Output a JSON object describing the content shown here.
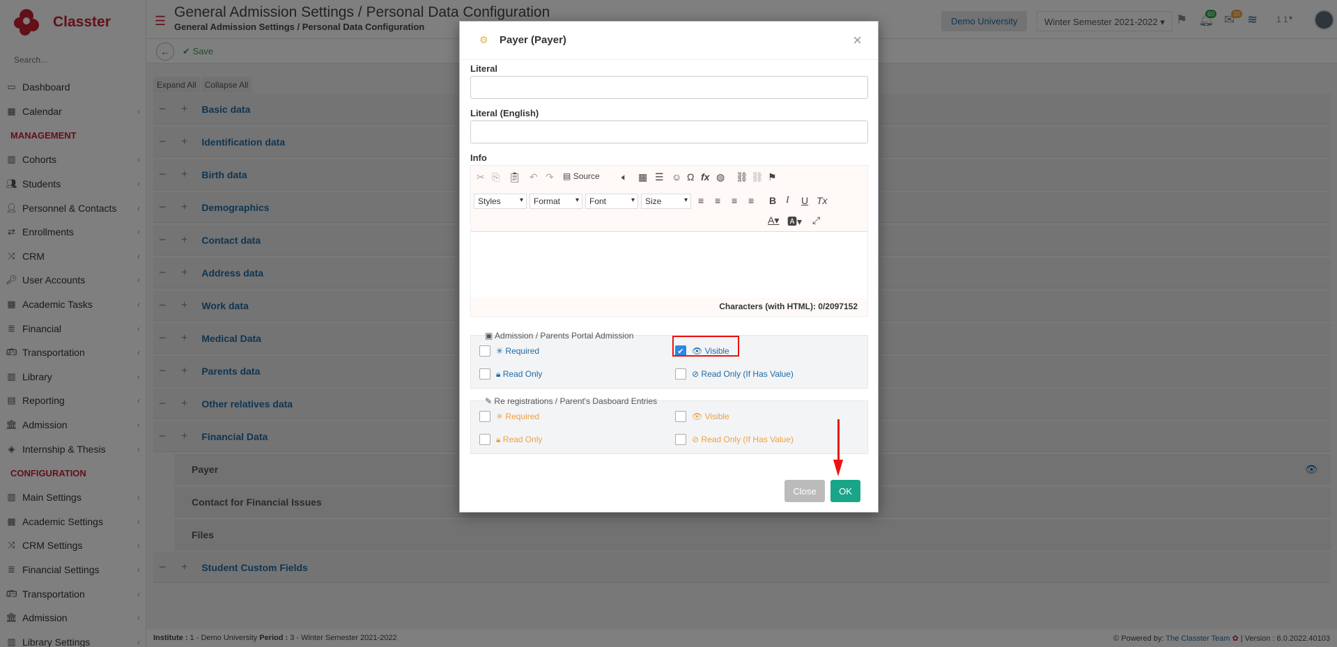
{
  "app": {
    "name": "Classter"
  },
  "sidebar": {
    "search_placeholder": "Search...",
    "items_top": [
      {
        "label": "Dashboard",
        "icon": "laptop-icon",
        "chevron": false
      },
      {
        "label": "Calendar",
        "icon": "calendar-icon",
        "chevron": true
      }
    ],
    "management_title": "MANAGEMENT",
    "management_items": [
      {
        "label": "Cohorts",
        "icon": "cohorts-icon"
      },
      {
        "label": "Students",
        "icon": "students-icon"
      },
      {
        "label": "Personnel & Contacts",
        "icon": "person-icon"
      },
      {
        "label": "Enrollments",
        "icon": "enrollments-icon"
      },
      {
        "label": "CRM",
        "icon": "crm-icon"
      },
      {
        "label": "User Accounts",
        "icon": "key-icon"
      },
      {
        "label": "Academic Tasks",
        "icon": "tasks-icon"
      },
      {
        "label": "Financial",
        "icon": "financial-icon"
      },
      {
        "label": "Transportation",
        "icon": "bus-icon"
      },
      {
        "label": "Library",
        "icon": "library-icon"
      },
      {
        "label": "Reporting",
        "icon": "printer-icon"
      },
      {
        "label": "Admission",
        "icon": "building-icon"
      },
      {
        "label": "Internship & Thesis",
        "icon": "cube-icon"
      }
    ],
    "configuration_title": "CONFIGURATION",
    "configuration_items": [
      {
        "label": "Main Settings",
        "icon": "settings-icon"
      },
      {
        "label": "Academic Settings",
        "icon": "academic-icon"
      },
      {
        "label": "CRM Settings",
        "icon": "crm-icon"
      },
      {
        "label": "Financial Settings",
        "icon": "financial-icon"
      },
      {
        "label": "Transportation",
        "icon": "bus-icon"
      },
      {
        "label": "Admission",
        "icon": "building-icon"
      },
      {
        "label": "Library Settings",
        "icon": "library-icon"
      }
    ]
  },
  "header": {
    "title": "General Admission Settings / Personal Data Configuration",
    "subtitle": "General Admission Settings / Personal Data Configuration",
    "institution": "Demo University",
    "period": "Winter Semester 2021-2022",
    "notifications_count": "60",
    "messages_count": "30",
    "user_label": "1 1"
  },
  "actionbar": {
    "save_label": "Save"
  },
  "content": {
    "expand_all": "Expand All",
    "collapse_all": "Collapse All",
    "sections": [
      "Basic data",
      "Identification data",
      "Birth data",
      "Demographics",
      "Contact data",
      "Address data",
      "Work data",
      "Medical Data",
      "Parents data",
      "Other relatives data",
      "Financial Data"
    ],
    "financial_subitems": [
      "Payer",
      "Contact for Financial Issues",
      "Files"
    ],
    "last_section": "Student Custom Fields"
  },
  "footer": {
    "institute_label": "Institute :",
    "institute_value": " 1 - Demo University ",
    "period_label": "Period :",
    "period_value": " 3 - Winter Semester 2021-2022",
    "powered_by": "Powered by:",
    "team": "The Classter Team",
    "version": "| Version : 6.0.2022.40103"
  },
  "modal": {
    "title": "Payer (Payer)",
    "literal_label": "Literal",
    "literal_value": "",
    "literal_en_label": "Literal (English)",
    "literal_en_value": "",
    "info_label": "Info",
    "editor": {
      "source_label": "Source",
      "styles": "Styles",
      "format": "Format",
      "font": "Font",
      "size": "Size",
      "char_count": "Characters (with HTML): 0/2097152"
    },
    "group1": {
      "title": "Admission / Parents Portal Admission",
      "required": "Required",
      "visible": "Visible",
      "read_only": "Read Only",
      "read_only_if": "Read Only (If Has Value)",
      "required_checked": false,
      "visible_checked": true,
      "read_only_checked": false,
      "read_only_if_checked": false
    },
    "group2": {
      "title": "Re registrations / Parent's Dasboard Entries",
      "required": "Required",
      "visible": "Visible",
      "read_only": "Read Only",
      "read_only_if": "Read Only (If Has Value)",
      "required_checked": false,
      "visible_checked": false,
      "read_only_checked": false,
      "read_only_if_checked": false
    },
    "close_label": "Close",
    "ok_label": "OK"
  },
  "colors": {
    "brand": "#c62033",
    "link": "#1e6aa5",
    "ok": "#1aa589",
    "highlight": "#ee1111",
    "warning": "#f0a040"
  }
}
